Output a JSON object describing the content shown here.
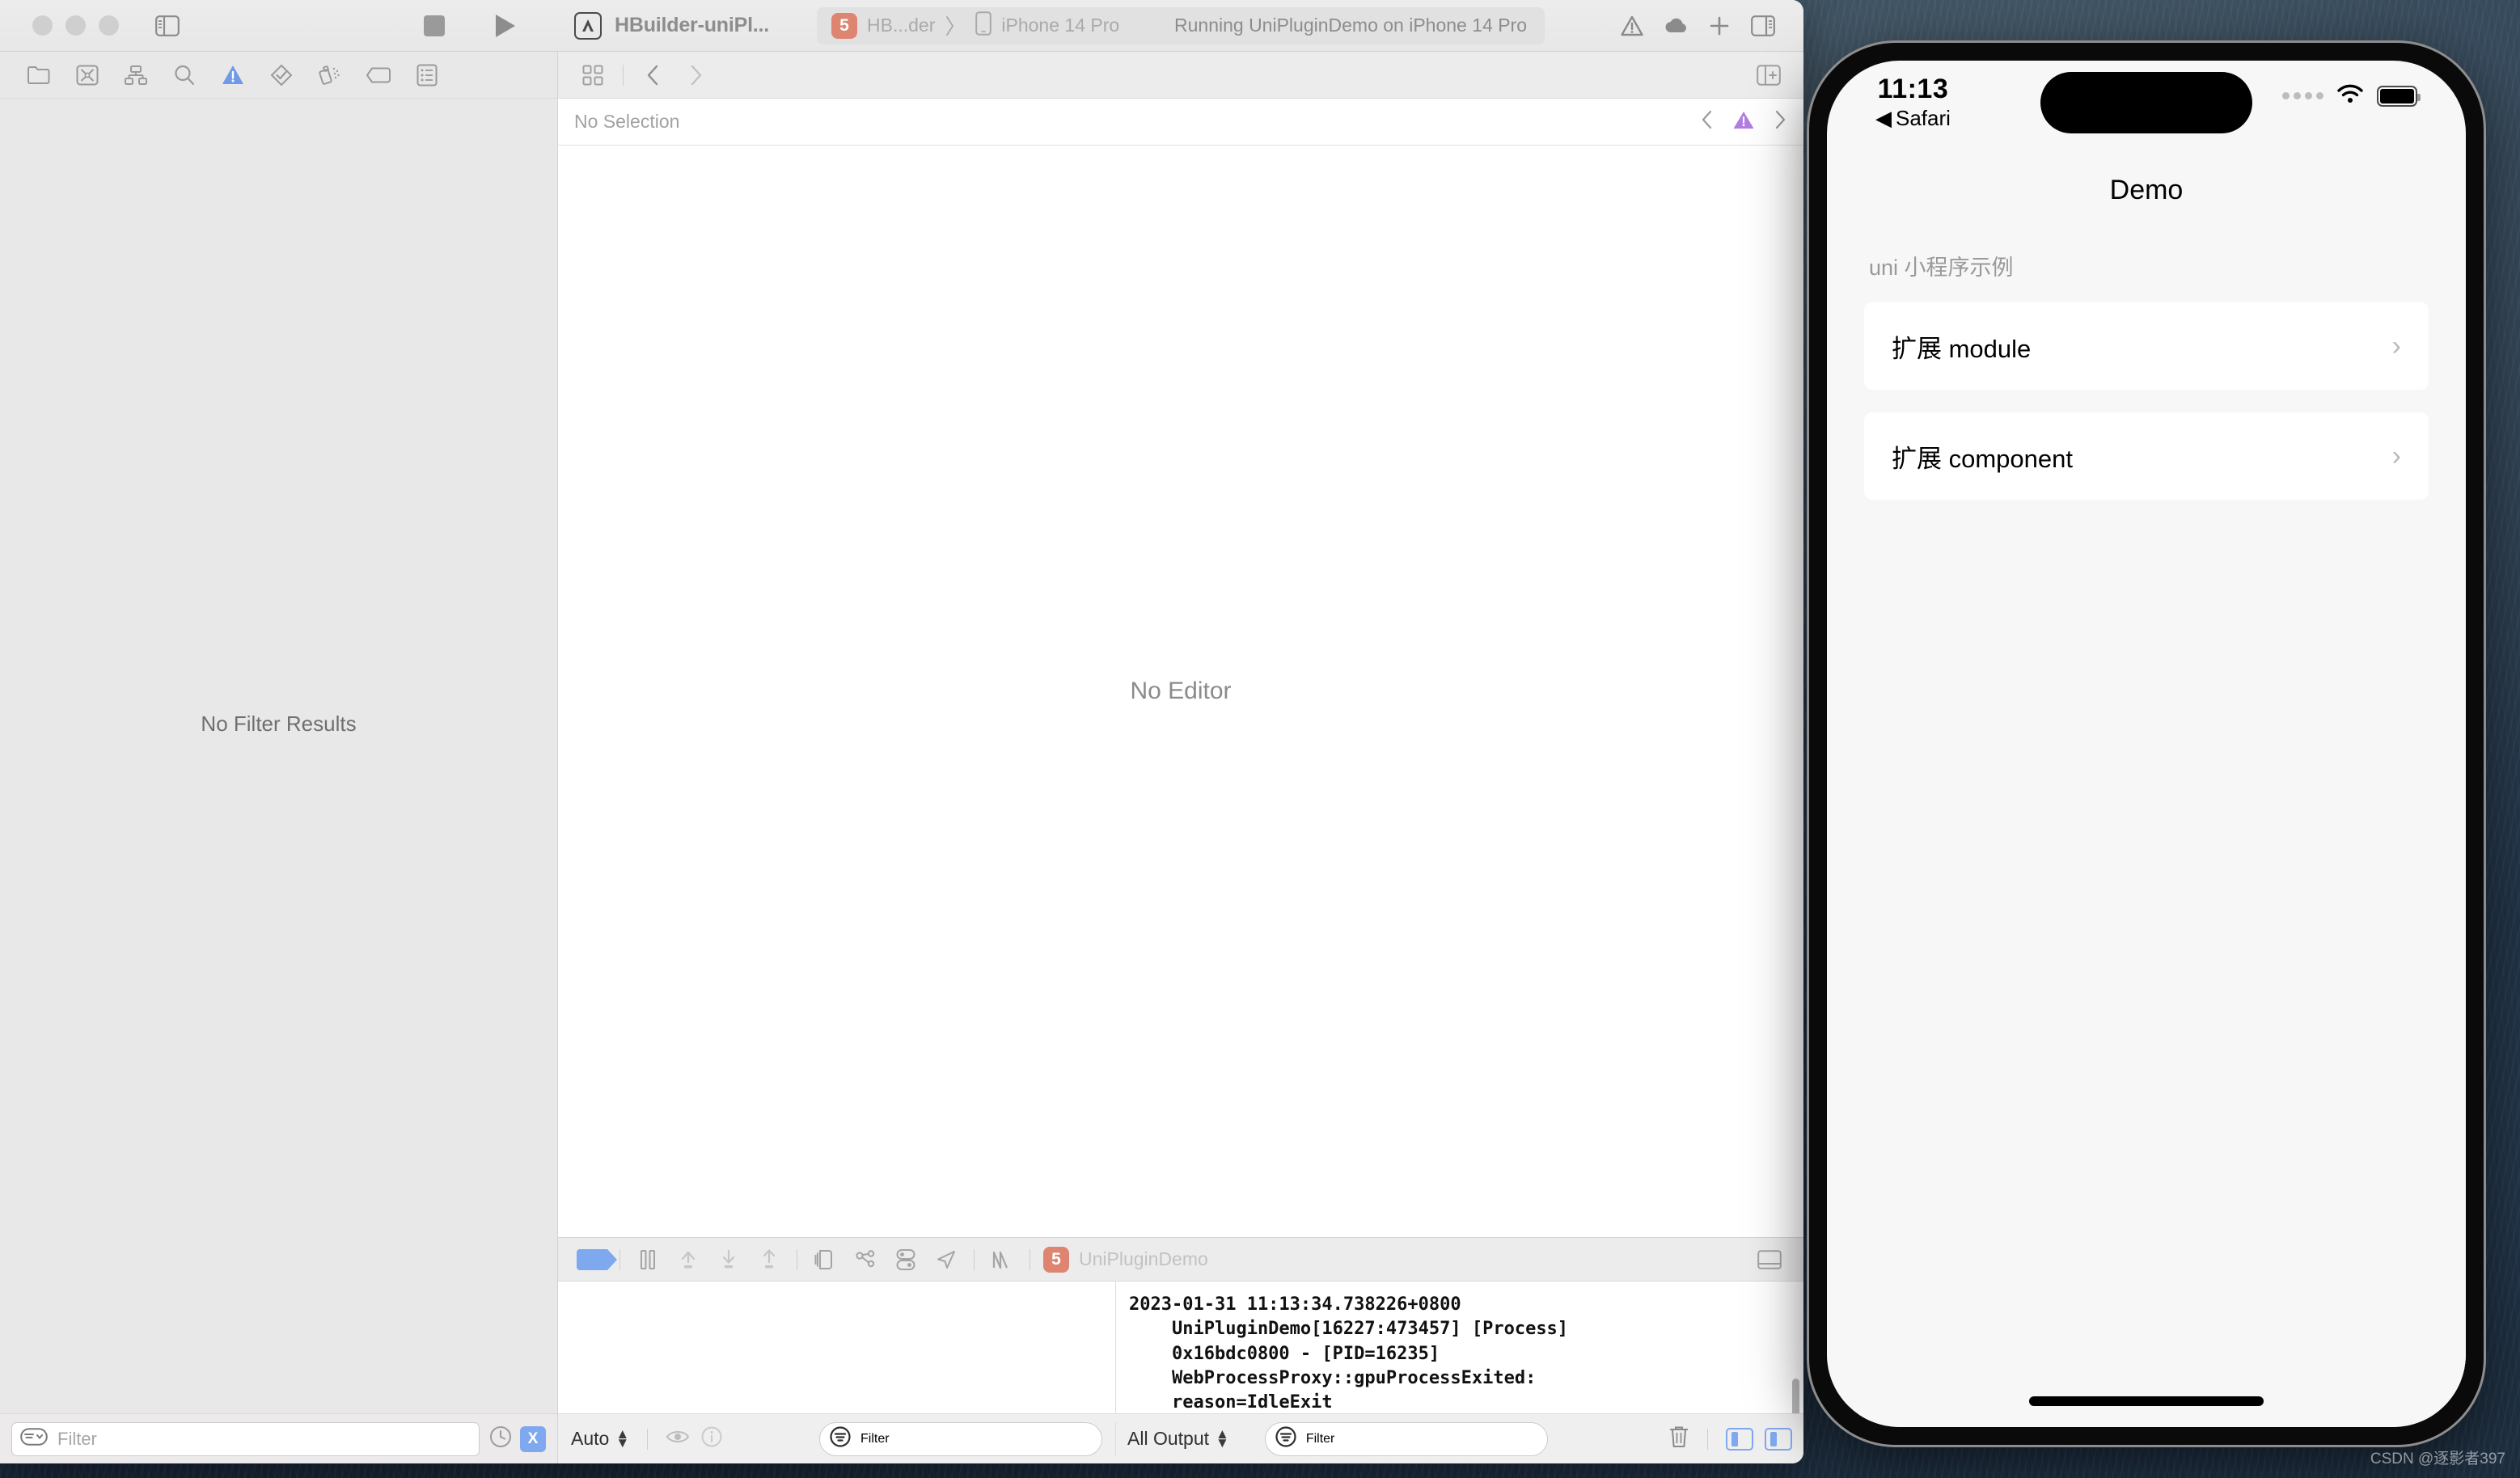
{
  "window": {
    "traffic_lights": [
      "close",
      "minimize",
      "zoom"
    ],
    "project_name": "HBuilder-uniPl...",
    "scheme": {
      "project_label": "HB...der",
      "separator": "〉",
      "device_label": "iPhone 14 Pro"
    },
    "status_text": "Running UniPluginDemo on iPhone 14 Pro",
    "toolbar_icons": {
      "sidebar_toggle": "sidebar-left-icon",
      "stop": "stop-square-icon",
      "run": "play-triangle-icon",
      "app_icon": "xcode-app-icon",
      "warning": "warning-triangle-icon",
      "cloud": "cloud-icon",
      "add": "plus-icon",
      "inspector_toggle": "sidebar-right-icon"
    }
  },
  "navigator": {
    "tabs": [
      {
        "name": "project-navigator",
        "icon": "folder-icon",
        "active": false
      },
      {
        "name": "source-control-navigator",
        "icon": "source-control-icon",
        "active": false
      },
      {
        "name": "symbol-navigator",
        "icon": "hierarchy-icon",
        "active": false
      },
      {
        "name": "find-navigator",
        "icon": "search-icon",
        "active": false
      },
      {
        "name": "issue-navigator",
        "icon": "warning-triangle-icon",
        "active": true
      },
      {
        "name": "test-navigator",
        "icon": "diamond-check-icon",
        "active": false
      },
      {
        "name": "debug-navigator",
        "icon": "spray-icon",
        "active": false
      },
      {
        "name": "breakpoint-navigator",
        "icon": "breakpoint-tag-icon",
        "active": false
      },
      {
        "name": "report-navigator",
        "icon": "report-list-icon",
        "active": false
      }
    ],
    "empty_message": "No Filter Results",
    "filter_placeholder": "Filter",
    "filter_value": "",
    "footer_icons": [
      "recent-clock-icon",
      "source-control-x-badge"
    ],
    "x_badge_label": "X"
  },
  "editor": {
    "grid_icon": "grid-4-icon",
    "back_icon": "chevron-left-icon",
    "forward_icon": "chevron-right-icon",
    "split_icon": "split-editor-add-icon",
    "breadcrumb": "No Selection",
    "issue_prev_icon": "chevron-left-icon",
    "issue_icon": "warning-triangle-icon",
    "issue_next_icon": "chevron-right-icon",
    "empty_message": "No Editor",
    "issue_color": "#b07de0"
  },
  "debug_bar": {
    "icons": [
      {
        "name": "breakpoints-toggle",
        "icon": "breakpoint-pill-icon",
        "active": true
      },
      {
        "name": "pause-button",
        "icon": "pause-icon"
      },
      {
        "name": "step-over-button",
        "icon": "step-over-icon"
      },
      {
        "name": "step-into-button",
        "icon": "step-into-icon"
      },
      {
        "name": "step-out-button",
        "icon": "step-out-icon"
      },
      {
        "name": "view-hierarchy-button",
        "icon": "layers-icon"
      },
      {
        "name": "memory-graph-button",
        "icon": "memory-graph-icon"
      },
      {
        "name": "environment-overrides-button",
        "icon": "toggles-icon"
      },
      {
        "name": "simulate-location-button",
        "icon": "location-arrow-icon"
      },
      {
        "name": "instruments-button",
        "icon": "sparkline-icon"
      }
    ],
    "process_label": "UniPluginDemo",
    "process_icon": "html5-app-icon",
    "console_toggle_icon": "console-panel-icon"
  },
  "console": {
    "lines": [
      "2023-01-31 11:13:34.738226+0800",
      "    UniPluginDemo[16227:473457] [Process]",
      "    0x16bdc0800 - [PID=16235]",
      "    WebProcessProxy::gpuProcessExited:",
      "    reason=IdleExit"
    ]
  },
  "debug_footer": {
    "variables_scope": "Auto",
    "eye_icon": "eye-icon",
    "info_icon": "info-circle-icon",
    "variables_filter_placeholder": "Filter",
    "output_scope": "All Output",
    "console_filter_placeholder": "Filter",
    "trash_icon": "trash-icon",
    "variables-panel-toggle": "panel-left-icon",
    "console-panel-toggle": "panel-right-icon"
  },
  "simulator": {
    "status_bar": {
      "time": "11:13",
      "back_app": "Safari",
      "back_arrow": "◀",
      "signal_icon": "signal-dots-icon",
      "wifi_icon": "wifi-icon",
      "battery_icon": "battery-icon"
    },
    "nav_title": "Demo",
    "list_header": "uni 小程序示例",
    "list_items": [
      {
        "label": "扩展 module",
        "chevron": "›"
      },
      {
        "label": "扩展 component",
        "chevron": "›"
      }
    ]
  },
  "watermark": "CSDN @逐影者397"
}
